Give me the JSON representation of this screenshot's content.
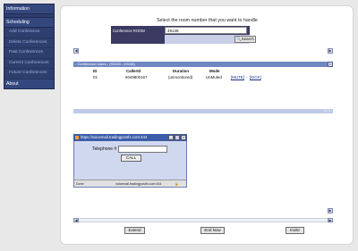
{
  "sidebar": {
    "header": "Information",
    "items": [
      {
        "label": "Scheduling",
        "type": "section"
      },
      {
        "label": "Add Conference",
        "type": "item"
      },
      {
        "label": "Delete Conferences",
        "type": "item"
      },
      {
        "label": "Past Conferences",
        "type": "item"
      },
      {
        "label": "Current Conferences",
        "type": "item"
      },
      {
        "label": "Future Conferences",
        "type": "item"
      },
      {
        "label": "About",
        "type": "section"
      }
    ]
  },
  "main": {
    "prompt": "Select the room number that you want to handle",
    "search": {
      "label": "Conference ROOM",
      "value": "49138",
      "button": "Search"
    },
    "table": {
      "title": "- Conference Users - (93100 - 49138)",
      "close": "x",
      "columns": [
        "ID",
        "CallerId",
        "Duration",
        "Mode"
      ],
      "rows": [
        {
          "id": "01",
          "caller_id": "6049800167",
          "duration": "(unmonitored)",
          "mode": "UnMuted",
          "actions": [
            "[MUTE]",
            "[KICK]"
          ]
        }
      ],
      "scroll_position": "1 / 1"
    },
    "popup": {
      "title": "https://voicemail.tradingpostfx.com:444",
      "telephone_label": "Telephone #",
      "telephone_value": "",
      "call_button": "CALL",
      "status_left": "Done",
      "status_right": "voicemail.tradingpostfx.com:444"
    },
    "actions": {
      "extend": "Extend",
      "end_now": "End Now",
      "invite": "Invite"
    }
  }
}
